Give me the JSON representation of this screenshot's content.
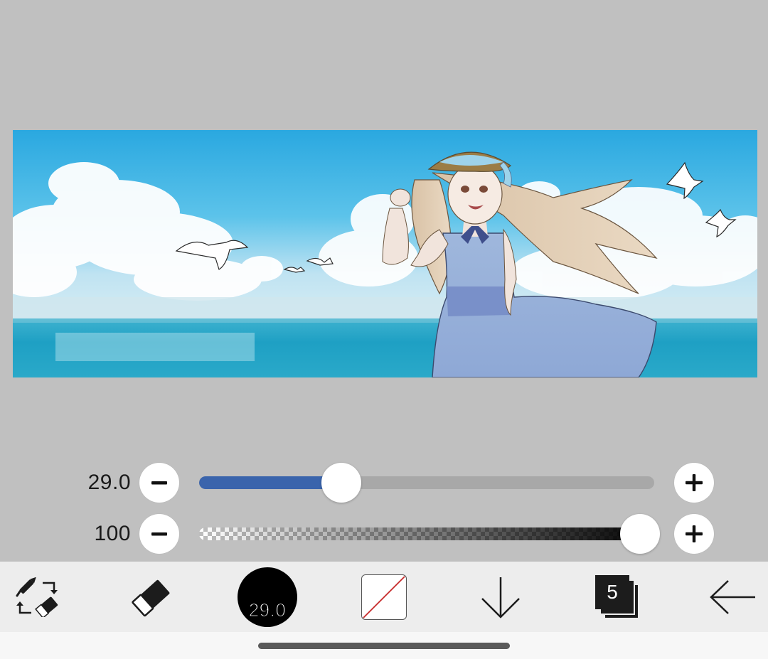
{
  "canvas": {
    "artwork_name": "beach-girl-illustration"
  },
  "brush_size_slider": {
    "value_label": "29.0",
    "fill_fraction": 0.3,
    "accent_color": "#3a64ac"
  },
  "opacity_slider": {
    "value_label": "100",
    "fill_fraction": 1.0
  },
  "toolbar": {
    "brush_size_label": "29.0",
    "layer_count": "5",
    "icons": {
      "swap": "swap-brush-eraser-icon",
      "eraser": "eraser-icon",
      "color": "color-swatch-transparent-icon",
      "download": "arrow-down-icon",
      "layers": "layers-icon",
      "back": "arrow-left-icon"
    }
  },
  "colors": {
    "background": "#c0c0c0",
    "toolbar": "#ededed",
    "slider_fill": "#3a64ac"
  }
}
